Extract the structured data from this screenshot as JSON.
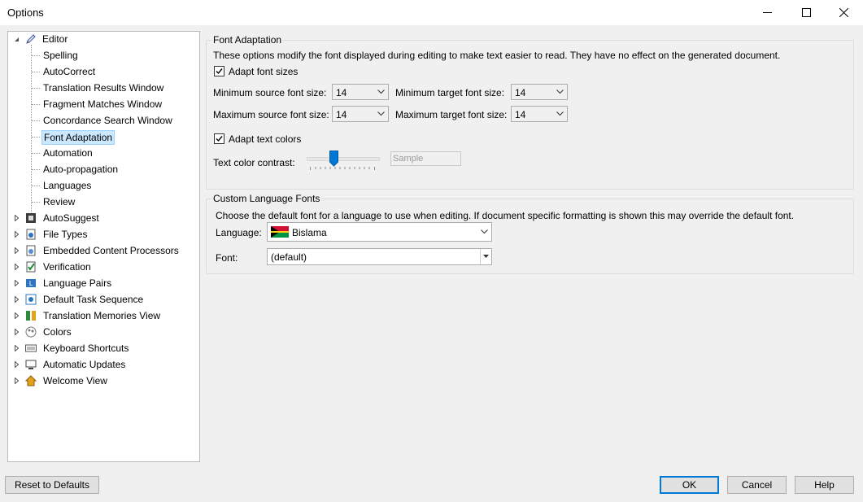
{
  "window": {
    "title": "Options"
  },
  "tree": {
    "editor": {
      "label": "Editor",
      "children": [
        "Spelling",
        "AutoCorrect",
        "Translation Results Window",
        "Fragment Matches Window",
        "Concordance Search Window",
        "Font Adaptation",
        "Automation",
        "Auto-propagation",
        "Languages",
        "Review"
      ],
      "selected": "Font Adaptation"
    },
    "nodes": [
      {
        "label": "AutoSuggest",
        "icon": "autosuggest-icon"
      },
      {
        "label": "File Types",
        "icon": "file-types-icon"
      },
      {
        "label": "Embedded Content Processors",
        "icon": "embedded-content-icon"
      },
      {
        "label": "Verification",
        "icon": "verification-icon"
      },
      {
        "label": "Language Pairs",
        "icon": "language-pairs-icon"
      },
      {
        "label": "Default Task Sequence",
        "icon": "task-sequence-icon"
      },
      {
        "label": "Translation Memories View",
        "icon": "translation-memories-icon"
      },
      {
        "label": "Colors",
        "icon": "colors-icon"
      },
      {
        "label": "Keyboard Shortcuts",
        "icon": "keyboard-icon"
      },
      {
        "label": "Automatic Updates",
        "icon": "automatic-updates-icon"
      },
      {
        "label": "Welcome View",
        "icon": "home-icon"
      }
    ]
  },
  "font_adaptation": {
    "group_title": "Font Adaptation",
    "description": "These options modify the font displayed during editing to make text easier to read. They have no effect on the generated document.",
    "adapt_font_sizes": {
      "label": "Adapt font sizes",
      "checked": true
    },
    "min_source": {
      "label": "Minimum source font size:",
      "value": "14"
    },
    "min_target": {
      "label": "Minimum target font size:",
      "value": "14"
    },
    "max_source": {
      "label": "Maximum source font size:",
      "value": "14"
    },
    "max_target": {
      "label": "Maximum target font size:",
      "value": "14"
    },
    "adapt_text_colors": {
      "label": "Adapt text colors",
      "checked": true
    },
    "contrast": {
      "label": "Text color contrast:",
      "sample": "Sample"
    }
  },
  "custom_fonts": {
    "group_title": "Custom Language Fonts",
    "description": "Choose the default font for a language to use when editing. If document specific formatting is shown this may override the default font.",
    "language": {
      "label": "Language:",
      "value": "Bislama"
    },
    "font": {
      "label": "Font:",
      "value": "(default)"
    }
  },
  "buttons": {
    "reset": "Reset to Defaults",
    "ok": "OK",
    "cancel": "Cancel",
    "help": "Help"
  },
  "colors": {
    "selection_bg": "#cce8ff",
    "selection_border": "#99d1ff",
    "accent": "#0078d7"
  }
}
